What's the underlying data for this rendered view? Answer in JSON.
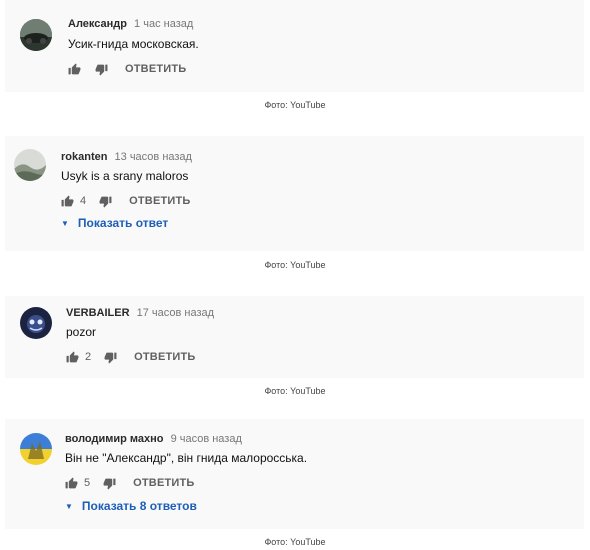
{
  "comments": [
    {
      "author": "Александр",
      "time": "1 час назад",
      "text": "Усик-гнида московская.",
      "likes": "",
      "reply_label": "ОТВЕТИТЬ"
    },
    {
      "author": "rokanten",
      "time": "13 часов назад",
      "text": "Usyk is a srany maloros",
      "likes": "4",
      "reply_label": "ОТВЕТИТЬ",
      "show_replies": "Показать ответ"
    },
    {
      "author": "VERBAILER",
      "time": "17 часов назад",
      "text": "pozor",
      "likes": "2",
      "reply_label": "ОТВЕТИТЬ"
    },
    {
      "author": "володимир махно",
      "time": "9 часов назад",
      "text": "Він не \"Александр\", він гнида малоросська.",
      "likes": "5",
      "reply_label": "ОТВЕТИТЬ",
      "show_replies": "Показать 8 ответов"
    }
  ],
  "captions": [
    "Фото: YouTube",
    "Фото: YouTube",
    "Фото: YouTube",
    "Фото: YouTube"
  ],
  "icons": {
    "like": "thumbs-up-icon",
    "dislike": "thumbs-down-icon",
    "expand": "triangle-down-icon"
  }
}
